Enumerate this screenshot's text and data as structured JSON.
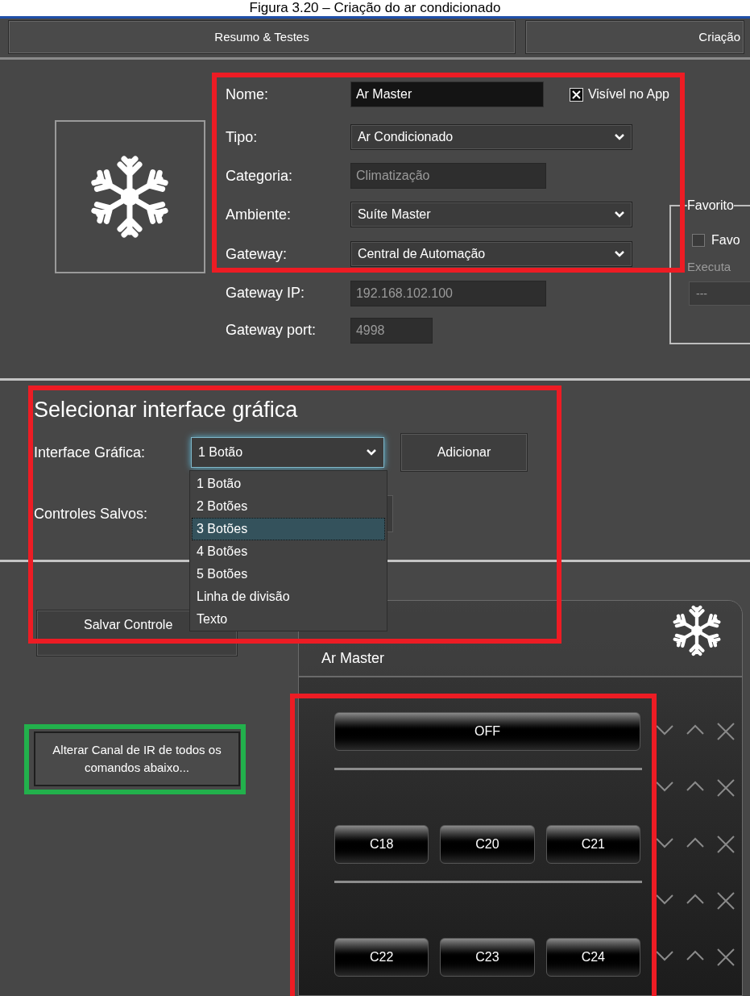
{
  "caption": "Figura 3.20 – Criação do ar condicionado",
  "tabs": [
    {
      "label": "Resumo & Testes"
    },
    {
      "label": "Criação"
    }
  ],
  "device_form": {
    "fields": [
      {
        "label": "Nome:",
        "value": "Ar Master",
        "kind": "text"
      },
      {
        "label": "Tipo:",
        "value": "Ar Condicionado",
        "kind": "dropdown"
      },
      {
        "label": "Categoria:",
        "value": "Climatização",
        "kind": "readonly"
      },
      {
        "label": "Ambiente:",
        "value": "Suíte Master",
        "kind": "dropdown"
      },
      {
        "label": "Gateway:",
        "value": "Central de Automação",
        "kind": "dropdown"
      },
      {
        "label": "Gateway IP:",
        "value": "192.168.102.100",
        "kind": "readonly"
      },
      {
        "label": "Gateway port:",
        "value": "4998",
        "kind": "short"
      }
    ],
    "visible_in_app": {
      "label": "Visível no App",
      "checked": true
    }
  },
  "favorites": {
    "title": "Favorito",
    "checkbox": {
      "label": "Favo",
      "checked": false
    },
    "action_label": "Executa",
    "action_value": "---"
  },
  "interface_section": {
    "title": "Selecionar interface gráfica",
    "interface_label": "Interface Gráfica:",
    "interface_value": "1 Botão",
    "add_button": "Adicionar",
    "saved_label": "Controles Salvos:",
    "save_button": "Salvar Controle",
    "options": [
      {
        "label": "1 Botão",
        "selected": false
      },
      {
        "label": "2 Botões",
        "selected": false
      },
      {
        "label": "3 Botões",
        "selected": true
      },
      {
        "label": "4 Botões",
        "selected": false
      },
      {
        "label": "5 Botões",
        "selected": false
      },
      {
        "label": "Linha de divisão",
        "selected": false
      },
      {
        "label": "Texto",
        "selected": false
      }
    ]
  },
  "change_ir_button": "Alterar Canal de IR de todos os comandos abaixo...",
  "preview": {
    "title": "Ar Master",
    "rows": [
      {
        "kind": "buttons",
        "buttons": [
          "OFF"
        ]
      },
      {
        "kind": "divider"
      },
      {
        "kind": "buttons",
        "buttons": [
          "C18",
          "C20",
          "C21"
        ]
      },
      {
        "kind": "divider"
      },
      {
        "kind": "buttons",
        "buttons": [
          "C22",
          "C23",
          "C24"
        ]
      }
    ]
  },
  "annotations": [
    {
      "color": "#ed1c24"
    },
    {
      "color": "#ed1c24"
    },
    {
      "color": "#ed1c24"
    },
    {
      "color": "#22b14c"
    }
  ]
}
